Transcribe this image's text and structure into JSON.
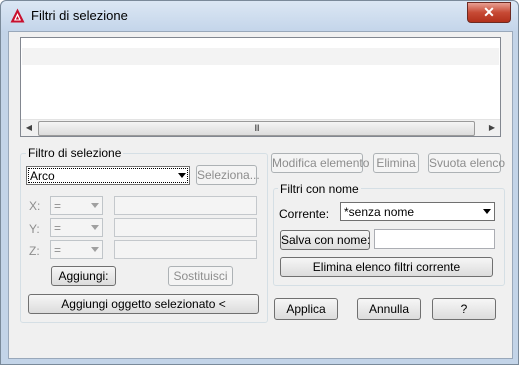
{
  "window": {
    "title": "Filtri di selezione",
    "close_label": "✕"
  },
  "listbox": {
    "scroll_left": "◀",
    "scroll_right": "▶",
    "thumb_grip": "III"
  },
  "filter_group": {
    "label": "Filtro di selezione",
    "object_type": "Arco",
    "select_button": "Seleziona...",
    "x_label": "X:",
    "y_label": "Y:",
    "z_label": "Z:",
    "operator": "=",
    "add_button": "Aggiungi:",
    "replace_button": "Sostituisci",
    "add_selected_button": "Aggiungi oggetto selezionato <"
  },
  "actions": {
    "edit_item": "Modifica elemento",
    "delete": "Elimina",
    "clear_list": "Svuota elenco"
  },
  "named_filters": {
    "label": "Filtri con nome",
    "current_label": "Corrente:",
    "current_value": "*senza nome",
    "save_as_button": "Salva con nome:",
    "save_as_value": "",
    "delete_current_button": "Elimina elenco filtri corrente"
  },
  "footer": {
    "apply": "Applica",
    "cancel": "Annulla",
    "help": "?"
  },
  "colors": {
    "title_bar": "#c4d5ea",
    "close_button": "#c74a35",
    "dialog_bg": "#f0f0f0"
  }
}
